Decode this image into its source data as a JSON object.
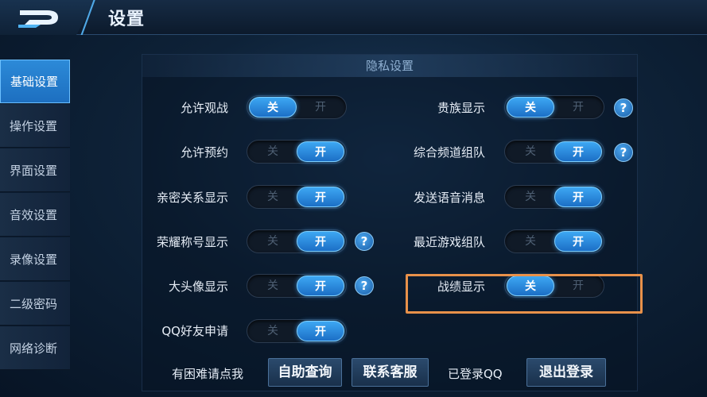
{
  "header": {
    "title": "设置",
    "back_icon": "back-arrow-logo-icon"
  },
  "sidebar": {
    "items": [
      {
        "label": "基础设置",
        "active": true
      },
      {
        "label": "操作设置",
        "active": false
      },
      {
        "label": "界面设置",
        "active": false
      },
      {
        "label": "音效设置",
        "active": false
      },
      {
        "label": "录像设置",
        "active": false
      },
      {
        "label": "二级密码",
        "active": false
      },
      {
        "label": "网络诊断",
        "active": false
      }
    ]
  },
  "panel": {
    "title": "隐私设置",
    "left_settings": [
      {
        "label": "允许观战",
        "value": "关",
        "help": false
      },
      {
        "label": "允许预约",
        "value": "开",
        "help": false
      },
      {
        "label": "亲密关系显示",
        "value": "开",
        "help": false
      },
      {
        "label": "荣耀称号显示",
        "value": "开",
        "help": true
      },
      {
        "label": "大头像显示",
        "value": "开",
        "help": true
      },
      {
        "label": "QQ好友申请",
        "value": "开",
        "help": false
      }
    ],
    "right_settings": [
      {
        "label": "贵族显示",
        "value": "关",
        "help": true
      },
      {
        "label": "综合频道组队",
        "value": "开",
        "help": true
      },
      {
        "label": "发送语音消息",
        "value": "开",
        "help": false
      },
      {
        "label": "最近游戏组队",
        "value": "开",
        "help": false
      },
      {
        "label": "战绩显示",
        "value": "关",
        "help": false
      }
    ],
    "toggle_off_label": "关",
    "toggle_on_label": "开",
    "help_glyph": "?"
  },
  "footer": {
    "help_text": "有困难请点我",
    "self_service_button": "自助查询",
    "contact_button": "联系客服",
    "login_status": "已登录QQ",
    "logout_button": "退出登录"
  },
  "colors": {
    "accent": "#2a8ae0",
    "highlight_outline": "#e8914a"
  }
}
